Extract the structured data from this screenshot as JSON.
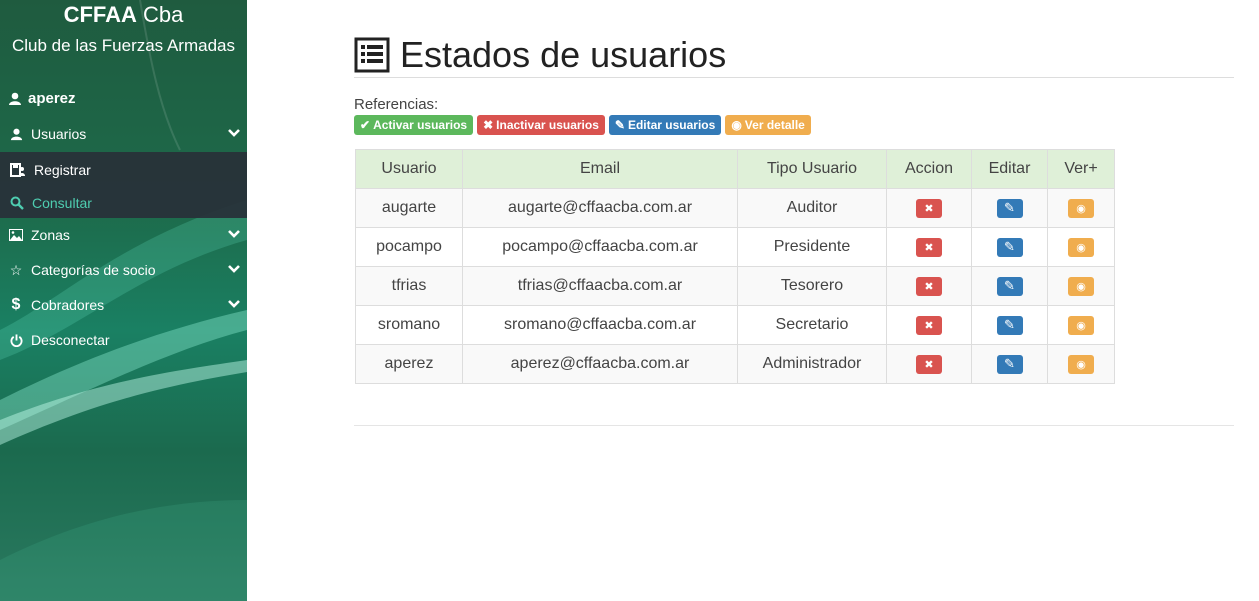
{
  "sidebar": {
    "brand_bold": "CFFAA",
    "brand_rest": " Cba",
    "club": "Club de las Fuerzas Armadas",
    "username": "aperez",
    "items": [
      {
        "label": "Usuarios",
        "icon": "user-icon"
      },
      {
        "label": "Zonas",
        "icon": "image-icon"
      },
      {
        "label": "Categorías de socio",
        "icon": "star-icon"
      },
      {
        "label": "Cobradores",
        "icon": "dollar-icon"
      },
      {
        "label": "Desconectar",
        "icon": "power-icon"
      }
    ],
    "submenu": [
      {
        "label": "Registrar",
        "icon": "register-icon"
      },
      {
        "label": "Consultar",
        "icon": "search-icon"
      }
    ]
  },
  "main": {
    "title": "Estados de usuarios",
    "refs_label": "Referencias:",
    "badges": {
      "activar": "Activar usuarios",
      "inactivar": "Inactivar usuarios",
      "editar": "Editar usuarios",
      "ver": "Ver detalle"
    },
    "table": {
      "headers": [
        "Usuario",
        "Email",
        "Tipo Usuario",
        "Accion",
        "Editar",
        "Ver+"
      ],
      "rows": [
        {
          "usuario": "augarte",
          "email": "augarte@cffaacba.com.ar",
          "tipo": "Auditor"
        },
        {
          "usuario": "pocampo",
          "email": "pocampo@cffaacba.com.ar",
          "tipo": "Presidente"
        },
        {
          "usuario": "tfrias",
          "email": "tfrias@cffaacba.com.ar",
          "tipo": "Tesorero"
        },
        {
          "usuario": "sromano",
          "email": "sromano@cffaacba.com.ar",
          "tipo": "Secretario"
        },
        {
          "usuario": "aperez",
          "email": "aperez@cffaacba.com.ar",
          "tipo": "Administrador"
        }
      ]
    }
  },
  "colors": {
    "success": "#5cb85c",
    "danger": "#d9534f",
    "primary": "#337ab7",
    "warning": "#f0ad4e",
    "table_header": "#dff0d8",
    "active_sub": "#4ecdb0"
  }
}
